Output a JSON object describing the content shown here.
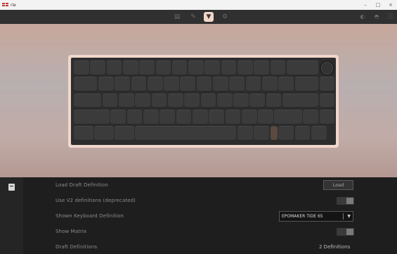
{
  "window": {
    "title": "rie",
    "minimize": "–",
    "maximize": "□",
    "close": "×"
  },
  "nav": {
    "icons": [
      "keyboard-icon",
      "brush-icon",
      "design-icon",
      "gear-icon"
    ],
    "active": "design-icon",
    "right_icons": [
      "github-icon",
      "discord-icon",
      "info-icon"
    ]
  },
  "settings": {
    "load_draft_label": "Load Draft Definition",
    "load_button": "Load",
    "v2_label": "Use V2 definitions (deprecated)",
    "shown_label": "Shown Keyboard Definition",
    "shown_value": "EPOMAKER TIDE 65",
    "show_matrix_label": "Show Matrix",
    "draft_label": "Draft Definitions",
    "draft_count": "2 Definitions"
  },
  "colors": {
    "accent": "#f2d7c9",
    "keycap": "#3b3b3b",
    "panel": "#1e1e1e"
  }
}
